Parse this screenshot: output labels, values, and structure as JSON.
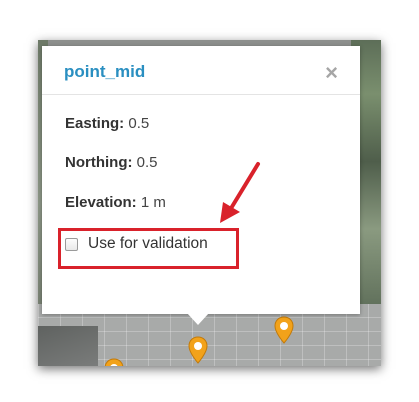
{
  "popup": {
    "title": "point_mid",
    "close_symbol": "×",
    "fields": {
      "easting": {
        "label": "Easting:",
        "value": "0.5"
      },
      "northing": {
        "label": "Northing:",
        "value": "0.5"
      },
      "elevation": {
        "label": "Elevation:",
        "value": "1 m"
      }
    },
    "validation": {
      "label": "Use for validation",
      "checked": false
    }
  },
  "annotation": {
    "highlight_color": "#d9222b",
    "arrow_color": "#d9222b"
  },
  "map": {
    "marker_color": "#f2a21a",
    "marker_icon": "map-pin-icon"
  },
  "colors": {
    "title": "#2a8fc1",
    "close": "#a6a6a6"
  }
}
